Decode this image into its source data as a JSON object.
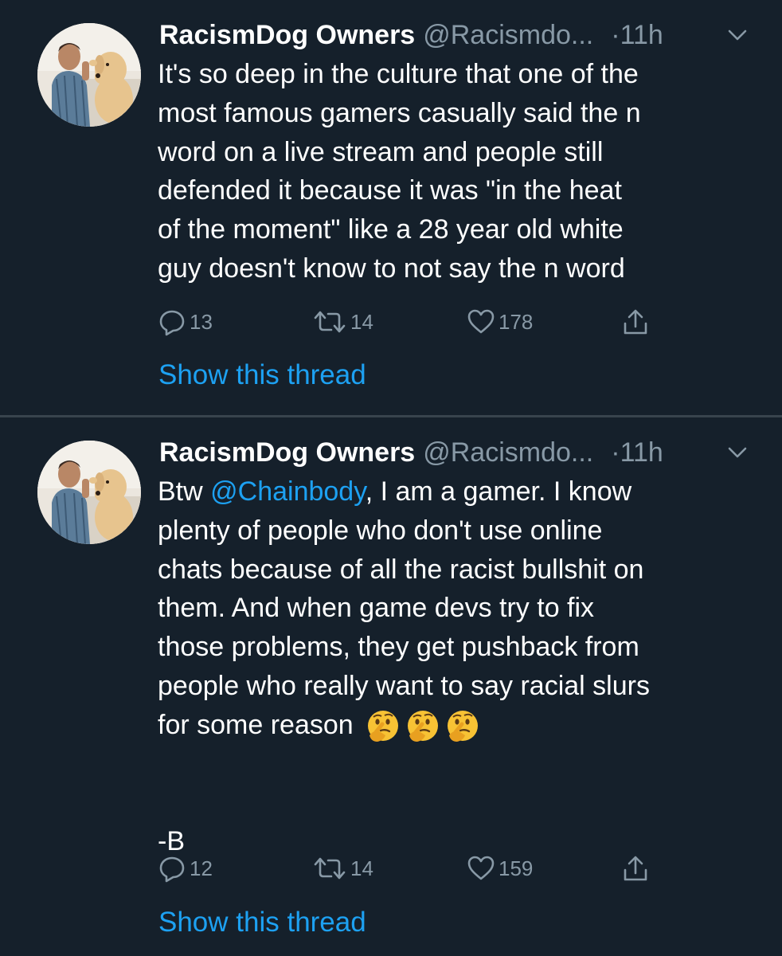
{
  "tweets": [
    {
      "name": "RacismDog Owners",
      "handle": "@Racismdo...",
      "dot": "·",
      "time": "11h",
      "text": "It's so deep in the culture that one of the\nmost famous gamers casually said the n\nword on a live stream and people still\ndefended it because it was \"in the heat\nof the moment\" like a 28 year old white\nguy doesn't know to not say the n word",
      "replies": "13",
      "retweets": "14",
      "likes": "178",
      "show_thread": "Show this thread"
    },
    {
      "name": "RacismDog Owners",
      "handle": "@Racismdo...",
      "dot": "·",
      "time": "11h",
      "text_prefix": "Btw ",
      "mention": "@Chainbody",
      "text_main": ", I am a gamer. I know\nplenty of people who don't use online\nchats because of all the racist bullshit on\nthem. And when game devs try to fix\nthose problems, they get pushback from\npeople who really want to say racial slurs\nfor some reason",
      "signature": "-B",
      "emojis": [
        "thinking-face-emoji",
        "thinking-face-emoji",
        "thinking-face-emoji"
      ],
      "replies": "12",
      "retweets": "14",
      "likes": "159",
      "show_thread": "Show this thread"
    }
  ],
  "colors": {
    "background": "#15202b",
    "text": "#ffffff",
    "secondary": "#8899a6",
    "link": "#1da1f2",
    "divider": "#38444d"
  },
  "icons": {
    "reply": "reply-icon",
    "retweet": "retweet-icon",
    "like": "heart-icon",
    "share": "share-icon",
    "menu": "chevron-down-icon"
  }
}
